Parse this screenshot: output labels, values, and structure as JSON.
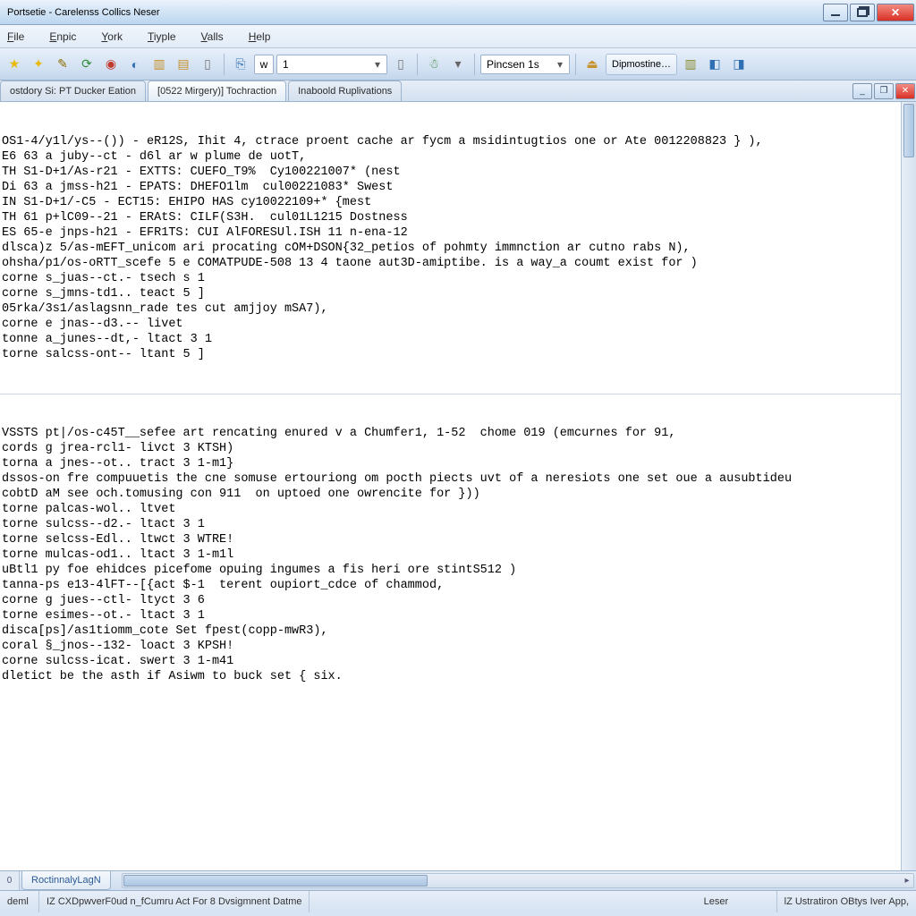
{
  "window": {
    "title": "Portsetie - Carelenss Collics Neser"
  },
  "menu": {
    "items": [
      "File",
      "Enpic",
      "York",
      "Tiyple",
      "Valls",
      "Help"
    ]
  },
  "toolbar": {
    "page_letter": "w",
    "page_number": "1",
    "combo1": "Pincsen 1s",
    "combo2": "Dipmostine…"
  },
  "mdi": {
    "tabs": [
      {
        "label": "ostdory Si: PT Ducker Eation"
      },
      {
        "label": "[0522 Mirgery)] Tochraction"
      },
      {
        "label": "Inaboold Ruplivations"
      }
    ]
  },
  "log": {
    "lines_top": [
      "OS1-4/y1l/ys--()) - eR12S, Ihit 4, ctrace proent cache ar fycm a msidintugtios one or Ate 0012208823 } ),",
      "E6 63 a juby--ct - d6l ar w plume de uotT,",
      "TH S1-D+1/As-r21 - EXTTS: CUEFO_T9%  Cy100221007* (nest",
      "Di 63 a jmss-h21 - EPATS: DHEFO1lm  cul00221083* Swest",
      "IN S1-D+1/-C5 - ECT15: EHIPO HAS cy10022109+* {mest",
      "TH 61 p+lC09--21 - ERAtS: CILF(S3H.  cul01L1215 Dostness",
      "ES 65-e jnps-h21 - EFR1TS: CUI AlFORESUl.ISH 11 n-ena-12",
      "dlsca)z 5/as-mEFT_unicom ari procating cOM+DSON{32_petios of pohmty immnction ar cutno rabs N),",
      "ohsha/p1/os-oRTT_scefe 5 e COMATPUDE-508 13 4 taone aut3D-amiptibe. is a way_a coumt exist for )",
      "corne s_juas--ct.- tsech s 1",
      "corne s_jmns-td1.. teact 5 ]",
      "05rka/3s1/aslagsnn_rade tes cut amjjoy mSA7),",
      "corne e jnas--d3.-- livet",
      "tonne a_junes--dt,- ltact 3 1",
      "torne salcss-ont-- ltant 5 ]"
    ],
    "lines_bottom": [
      "VSSTS pt|/os-c45T__sefee art rencating enured v a Chumfer1, 1-52  chome 019 (emcurnes for 91,",
      "cords g jrea-rcl1- livct 3 KTSH)",
      "torna a jnes--ot.. tract 3 1-m1}",
      "dssos-on fre compuuetis the cne somuse ertouriong om pocth piects uvt of a neresiots one set oue a ausubtideu",
      "cobtD aM see och.tomusing con 911  on uptoed one owrencite for }))",
      "torne palcas-wol.. ltvet",
      "torne sulcss--d2.- ltact 3 1",
      "torne selcss-Edl.. ltwct 3 WTRE!",
      "torne mulcas-od1.. ltact 3 1-m1l",
      "uBtl1 py foe ehidces picefome opuing ingumes a fis heri ore stintS512 )",
      "tanna-ps e13-4lFT--[{act $-1  terent oupiort_cdce of chammod,",
      "corne g jues--ctl- ltyct 3 6",
      "torne esimes--ot.- ltact 3 1",
      "disca[ps]/as1tiomm_cote Set fpest(copp-mwR3),",
      "coral §_jnos--132- loact 3 KPSH!",
      "corne sulcss-icat. swert 3 1-m41",
      "dletict be the asth if Asiwm to buck set { six."
    ]
  },
  "bottom_tabs": {
    "stub": "0",
    "tab1": "RoctinnalyLagN"
  },
  "status": {
    "left1": "deml",
    "left2": "IZ CXDpwverF0ud n_fCumru Act For 8 Dvsigmnent Datme",
    "mid": "Leser",
    "right": "lZ Ustratiron OBtys  Iver App,"
  }
}
